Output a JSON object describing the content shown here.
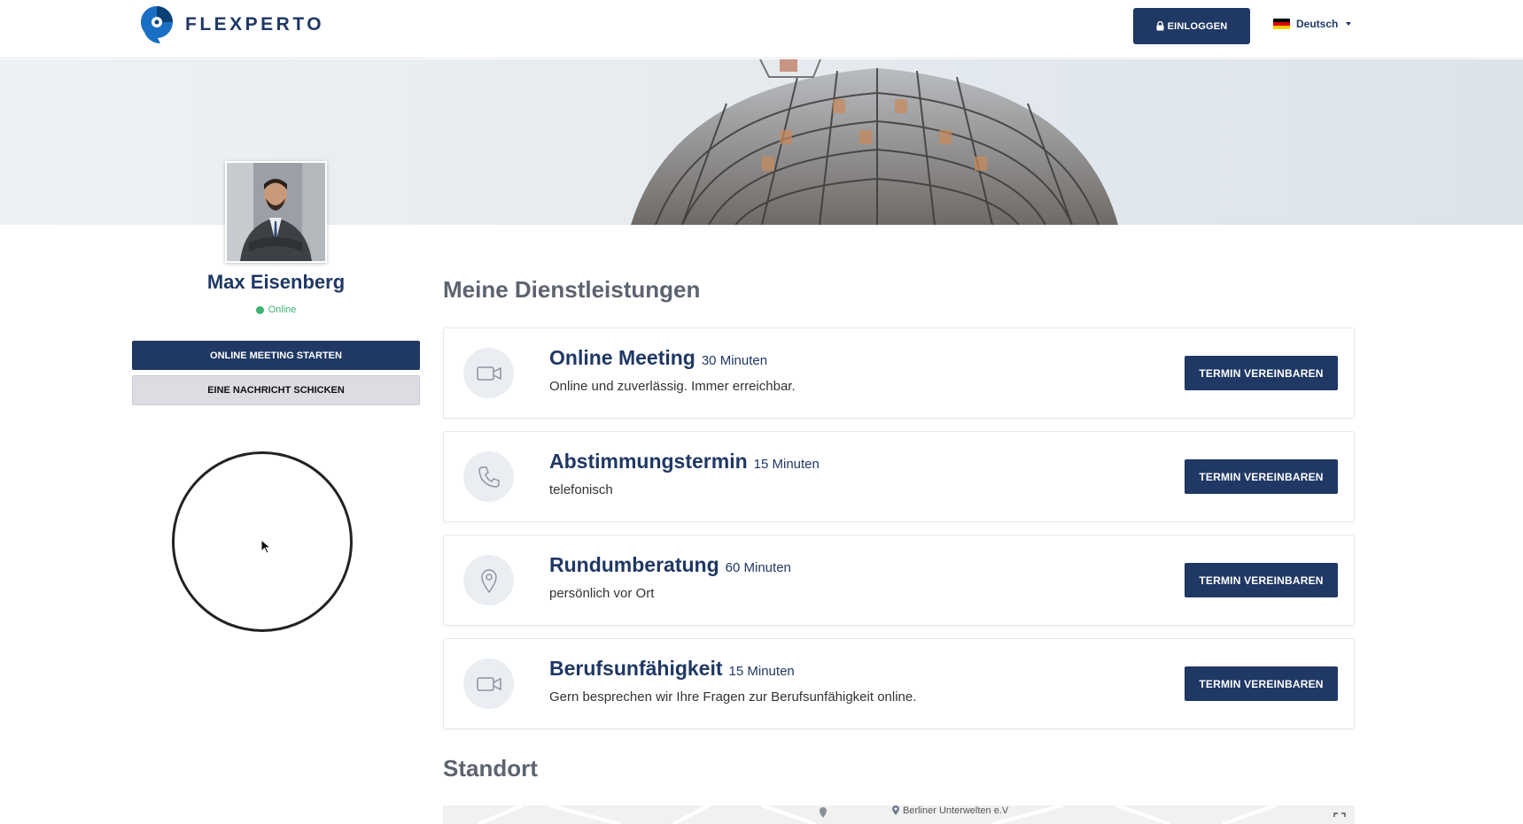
{
  "header": {
    "logo_text": "FLEXPERTO",
    "login_label": "EINLOGGEN",
    "language": "Deutsch"
  },
  "profile": {
    "name": "Max Eisenberg",
    "status": "Online",
    "primary_button": "ONLINE MEETING STARTEN",
    "secondary_button": "EINE NACHRICHT SCHICKEN"
  },
  "services": {
    "title": "Meine Dienstleistungen",
    "items": [
      {
        "icon": "video-camera-icon",
        "title": "Online Meeting",
        "duration": "30 Minuten",
        "description": "Online und zuverlässig. Immer erreichbar.",
        "button": "TERMIN VEREINBAREN"
      },
      {
        "icon": "phone-icon",
        "title": "Abstimmungstermin",
        "duration": "15 Minuten",
        "description": "telefonisch",
        "button": "TERMIN VEREINBAREN"
      },
      {
        "icon": "location-pin-icon",
        "title": "Rundumberatung",
        "duration": "60 Minuten",
        "description": "persönlich vor Ort",
        "button": "TERMIN VEREINBAREN"
      },
      {
        "icon": "video-camera-icon",
        "title": "Berufsunfähigkeit",
        "duration": "15 Minuten",
        "description": "Gern besprechen wir Ihre Fragen zur Berufsunfähigkeit online.",
        "button": "TERMIN VEREINBAREN"
      }
    ]
  },
  "location": {
    "title": "Standort",
    "map_label": "Berliner Unterwelten e.V"
  },
  "colors": {
    "primary": "#1f3864",
    "online": "#3cb371",
    "secondary_button_bg": "#dcdde3"
  }
}
